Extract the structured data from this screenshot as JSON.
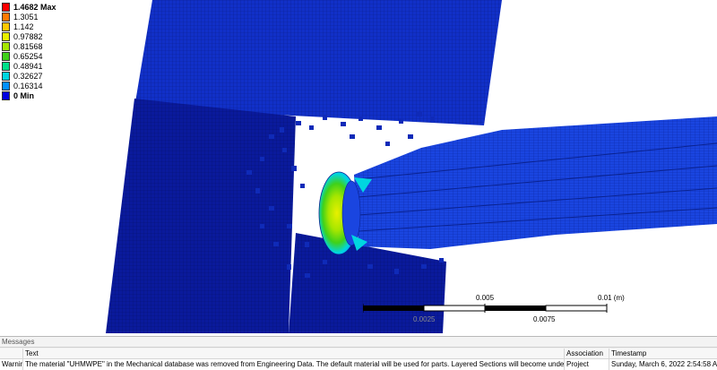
{
  "legend": {
    "entries": [
      {
        "label": "1.4682 Max",
        "color": "#ff0000",
        "bold": true
      },
      {
        "label": "1.3051",
        "color": "#ff7a00",
        "bold": false
      },
      {
        "label": "1.142",
        "color": "#ffc800",
        "bold": false
      },
      {
        "label": "0.97882",
        "color": "#e8f000",
        "bold": false
      },
      {
        "label": "0.81568",
        "color": "#a6e600",
        "bold": false
      },
      {
        "label": "0.65254",
        "color": "#3fd11a",
        "bold": false
      },
      {
        "label": "0.48941",
        "color": "#00e08a",
        "bold": false
      },
      {
        "label": "0.32627",
        "color": "#00d6e0",
        "bold": false
      },
      {
        "label": "0.16314",
        "color": "#0090ff",
        "bold": false
      },
      {
        "label": "0 Min",
        "color": "#0000e0",
        "bold": true
      }
    ]
  },
  "scale_bar": {
    "top_labels": [
      "0.005",
      "0.01 (m)"
    ],
    "bottom_labels": [
      "0.0025",
      "0.0075"
    ]
  },
  "model_colors": {
    "mesh_dark": "#0a1a9c",
    "mesh_mid": "#1130c8",
    "mesh_light": "#1a45e0",
    "background": "#ffffff"
  },
  "messages": {
    "title": "Messages",
    "columns": {
      "type": "",
      "text": "Text",
      "association": "Association",
      "timestamp": "Timestamp"
    },
    "rows": [
      {
        "type": "Warning",
        "text": "The material \"UHMWPE\" in the Mechanical database was removed from Engineering Data.  The default material will be used for parts.  Layered Sections will become underdefined.",
        "association": "Project",
        "timestamp": "Sunday, March 6, 2022 2:54:58 AM"
      }
    ]
  }
}
